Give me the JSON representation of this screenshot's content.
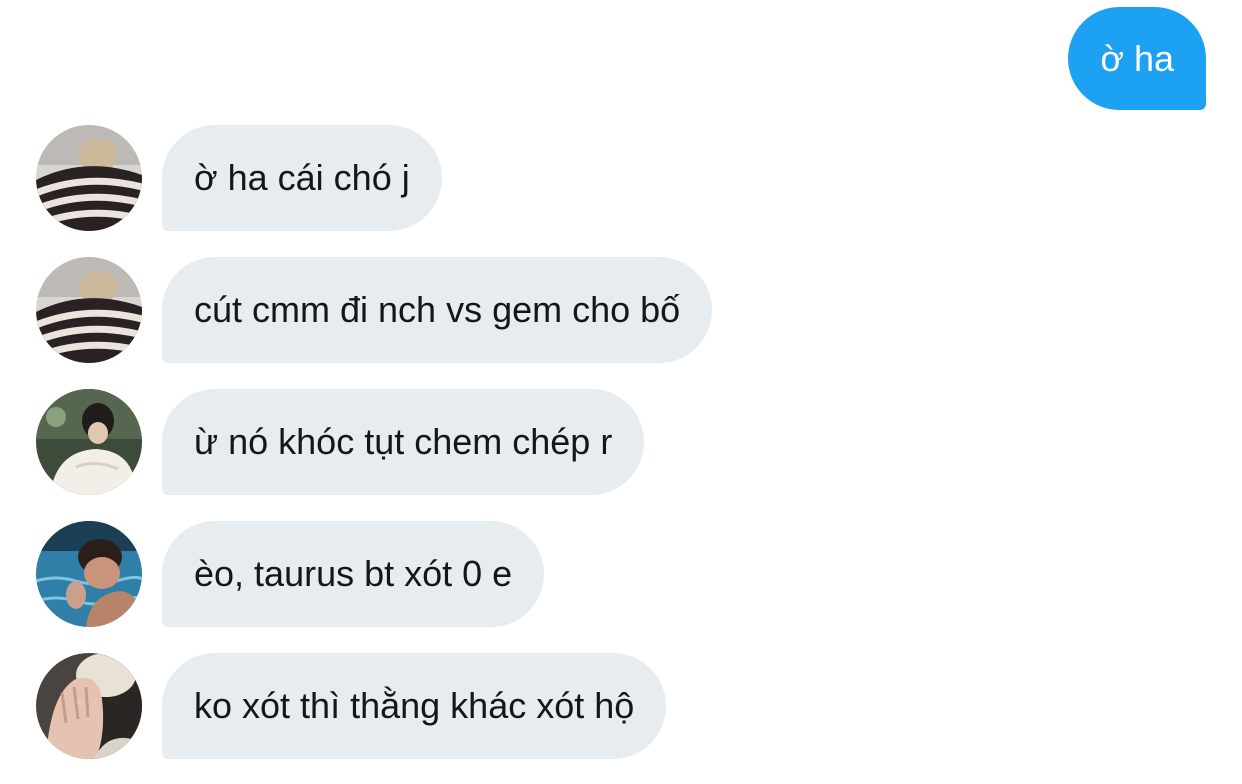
{
  "conversation": {
    "sent": [
      {
        "text": "ờ ha"
      }
    ],
    "received": [
      {
        "avatar": "user-avatar-striped-sweater",
        "text": "ờ ha cái chó j"
      },
      {
        "avatar": "user-avatar-striped-sweater",
        "text": "cút cmm đi nch vs gem cho bố"
      },
      {
        "avatar": "user-avatar-white-shirt",
        "text": "ừ nó khóc tụt chem chép r"
      },
      {
        "avatar": "user-avatar-pool",
        "text": "èo, taurus bt xót 0 e"
      },
      {
        "avatar": "user-avatar-hands",
        "text": "ko xót thì thằng khác xót hộ"
      }
    ]
  },
  "colors": {
    "sent_bubble": "#1da1f2",
    "received_bubble": "#e6ecf0",
    "sent_text": "#ffffff",
    "received_text": "#14171a"
  }
}
